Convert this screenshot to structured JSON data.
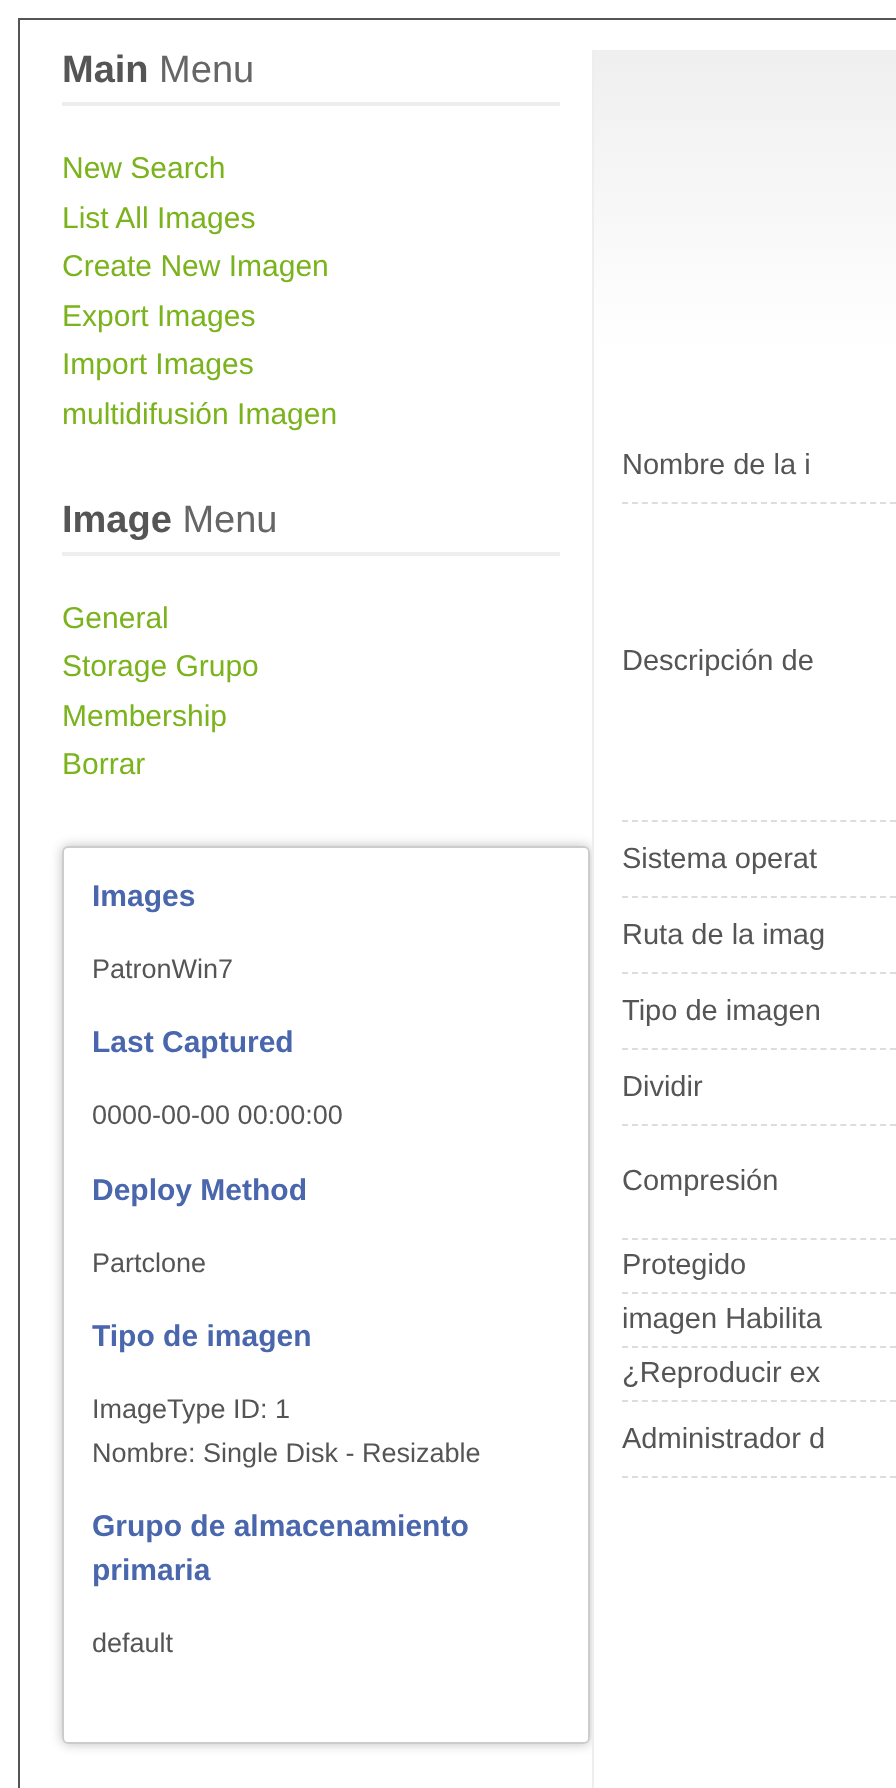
{
  "menus": [
    {
      "title": "**Main** Menu",
      "items": [
        "New Search",
        "List All Images",
        "Create New Imagen",
        "Export Images",
        "Import Images",
        "multidifusión Imagen"
      ]
    },
    {
      "title": "**Image** Menu",
      "items": [
        "General",
        "Storage Grupo",
        "Membership",
        "Borrar"
      ]
    }
  ],
  "info_card": {
    "sections": [
      {
        "heading": "Images",
        "value": "PatronWin7"
      },
      {
        "heading": "Last Captured",
        "value": "0000-00-00 00:00:00"
      },
      {
        "heading": "Deploy Method",
        "value": "Partclone"
      },
      {
        "heading": "Tipo de imagen",
        "value": "ImageType ID: 1\nNombre: Single Disk - Resizable"
      },
      {
        "heading": "Grupo de almacenamiento primaria",
        "value": "default"
      }
    ]
  },
  "form": {
    "fields": [
      {
        "label": "Nombre de la i",
        "kind": "input"
      },
      {
        "label": "Descripción de",
        "kind": "textarea"
      },
      {
        "label": "Sistema operat",
        "kind": "input"
      },
      {
        "label": "Ruta de la imag",
        "kind": "input"
      },
      {
        "label": "Tipo de imagen",
        "kind": "input"
      },
      {
        "label": "Dividir",
        "kind": "input"
      },
      {
        "label": "Compresión",
        "kind": "slider"
      },
      {
        "label": "Protegido",
        "kind": "checkbox"
      },
      {
        "label": "imagen Habilita",
        "kind": "checkbox"
      },
      {
        "label": "¿Reproducir ex",
        "kind": "checkbox"
      },
      {
        "label": "Administrador d",
        "kind": "input"
      }
    ]
  }
}
